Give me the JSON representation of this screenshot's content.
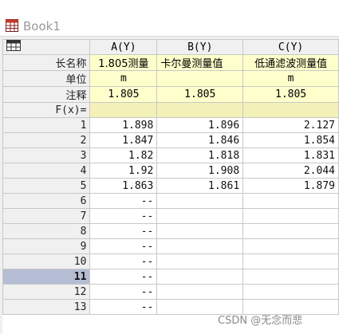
{
  "window": {
    "title": "Book1"
  },
  "columns": [
    {
      "header": "A(Y)",
      "long_name": "1.805测量",
      "unit": "m",
      "comment": "1.805",
      "fx": ""
    },
    {
      "header": "B(Y)",
      "long_name": "卡尔曼测量值",
      "unit": "",
      "comment": "1.805",
      "fx": ""
    },
    {
      "header": "C(Y)",
      "long_name": "低通滤波测量值",
      "unit": "m",
      "comment": "1.805",
      "fx": ""
    }
  ],
  "row_labels": {
    "long_name": "长名称",
    "unit": "单位",
    "comment": "注释",
    "fx": "F(x)="
  },
  "rows": [
    {
      "n": "1",
      "a": "1.898",
      "b": "1.896",
      "c": "2.127"
    },
    {
      "n": "2",
      "a": "1.847",
      "b": "1.846",
      "c": "1.854"
    },
    {
      "n": "3",
      "a": "1.82",
      "b": "1.818",
      "c": "1.831"
    },
    {
      "n": "4",
      "a": "1.92",
      "b": "1.908",
      "c": "2.044"
    },
    {
      "n": "5",
      "a": "1.863",
      "b": "1.861",
      "c": "1.879"
    },
    {
      "n": "6",
      "a": "--",
      "b": "",
      "c": ""
    },
    {
      "n": "7",
      "a": "--",
      "b": "",
      "c": ""
    },
    {
      "n": "8",
      "a": "--",
      "b": "",
      "c": ""
    },
    {
      "n": "9",
      "a": "--",
      "b": "",
      "c": ""
    },
    {
      "n": "10",
      "a": "--",
      "b": "",
      "c": ""
    },
    {
      "n": "11",
      "a": "--",
      "b": "",
      "c": ""
    },
    {
      "n": "12",
      "a": "--",
      "b": "",
      "c": ""
    },
    {
      "n": "13",
      "a": "--",
      "b": "",
      "c": ""
    }
  ],
  "selected_row": "11",
  "watermark": "CSDN @无念而悲",
  "icons": {
    "window": "spreadsheet-icon",
    "corner": "select-all-grid-icon"
  }
}
